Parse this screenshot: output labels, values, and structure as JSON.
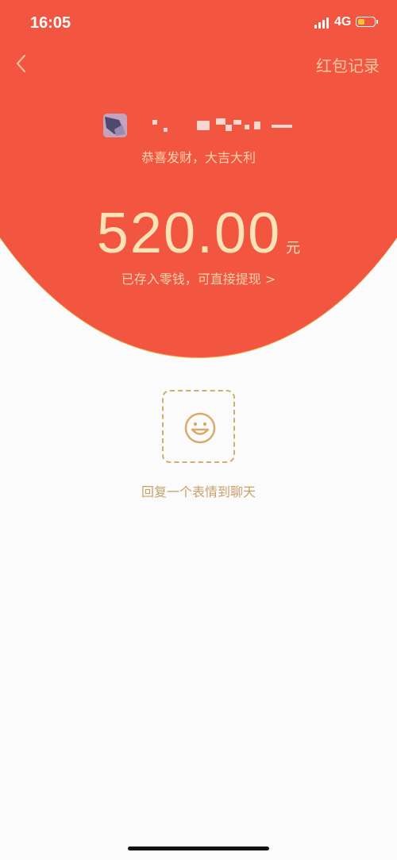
{
  "status_bar": {
    "time": "16:05",
    "network": "4G",
    "battery_level": 0.4,
    "battery_color": "#f6c534"
  },
  "nav": {
    "back_icon": "chevron-left-icon",
    "records_label": "红包记录"
  },
  "packet": {
    "greeting": "恭喜发财，大吉大利",
    "amount": "520.00",
    "unit": "元",
    "deposit_note": "已存入零钱，可直接提现 >"
  },
  "reply": {
    "icon": "smiley-face-icon",
    "label": "回复一个表情到聊天"
  },
  "colors": {
    "header_red": "#f25641",
    "gold_text": "#fce3b6",
    "reply_gold": "#c9a06a"
  }
}
